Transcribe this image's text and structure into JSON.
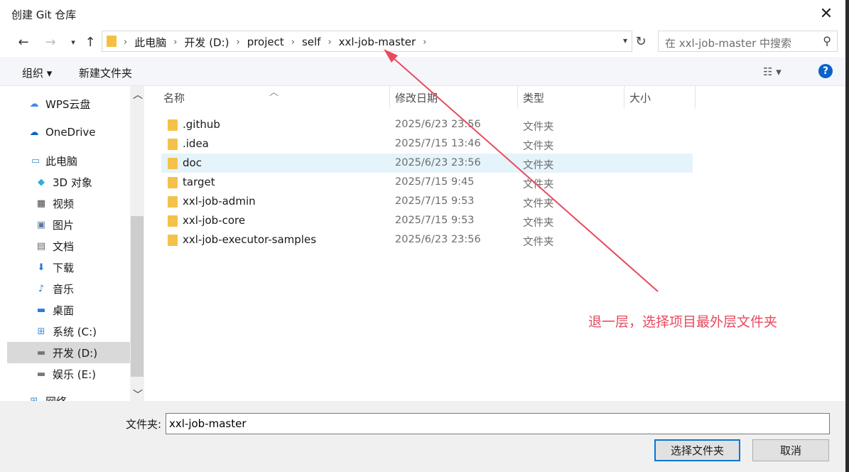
{
  "window": {
    "title": "创建 Git 仓库"
  },
  "address": {
    "crumbs": [
      "此电脑",
      "开发 (D:)",
      "project",
      "self",
      "xxl-job-master"
    ]
  },
  "search": {
    "placeholder": "在 xxl-job-master 中搜索"
  },
  "toolbar": {
    "organize": "组织 ▾",
    "new_folder": "新建文件夹",
    "view": "☷ ▾",
    "help": "?"
  },
  "nav": {
    "items": [
      {
        "label": "WPS云盘",
        "icon": "cloud-icon"
      },
      {
        "label": "OneDrive",
        "icon": "onedrive-cloud-icon"
      },
      {
        "label": "此电脑",
        "icon": "computer-icon"
      },
      {
        "label": "3D 对象",
        "icon": "cube-icon"
      },
      {
        "label": "视频",
        "icon": "video-icon"
      },
      {
        "label": "图片",
        "icon": "picture-icon"
      },
      {
        "label": "文档",
        "icon": "document-icon"
      },
      {
        "label": "下载",
        "icon": "download-icon"
      },
      {
        "label": "音乐",
        "icon": "music-icon"
      },
      {
        "label": "桌面",
        "icon": "desktop-icon"
      },
      {
        "label": "系统 (C:)",
        "icon": "drive-icon"
      },
      {
        "label": "开发 (D:)",
        "icon": "drive-icon",
        "selected": true
      },
      {
        "label": "娱乐 (E:)",
        "icon": "drive-icon"
      },
      {
        "label": "网络",
        "icon": "network-icon"
      }
    ]
  },
  "columns": {
    "name": "名称",
    "date": "修改日期",
    "type": "类型",
    "size": "大小"
  },
  "files": [
    {
      "name": ".github",
      "date": "2025/6/23 23:56",
      "type": "文件夹"
    },
    {
      "name": ".idea",
      "date": "2025/7/15 13:46",
      "type": "文件夹"
    },
    {
      "name": "doc",
      "date": "2025/6/23 23:56",
      "type": "文件夹"
    },
    {
      "name": "target",
      "date": "2025/7/15 9:45",
      "type": "文件夹"
    },
    {
      "name": "xxl-job-admin",
      "date": "2025/7/15 9:53",
      "type": "文件夹"
    },
    {
      "name": "xxl-job-core",
      "date": "2025/7/15 9:53",
      "type": "文件夹"
    },
    {
      "name": "xxl-job-executor-samples",
      "date": "2025/6/23 23:56",
      "type": "文件夹"
    }
  ],
  "footer": {
    "folder_label": "文件夹:",
    "folder_value": "xxl-job-master",
    "select_button": "选择文件夹",
    "cancel_button": "取消"
  },
  "annotation": {
    "text": "退一层，选择项目最外层文件夹",
    "color": "#e84a5f"
  }
}
